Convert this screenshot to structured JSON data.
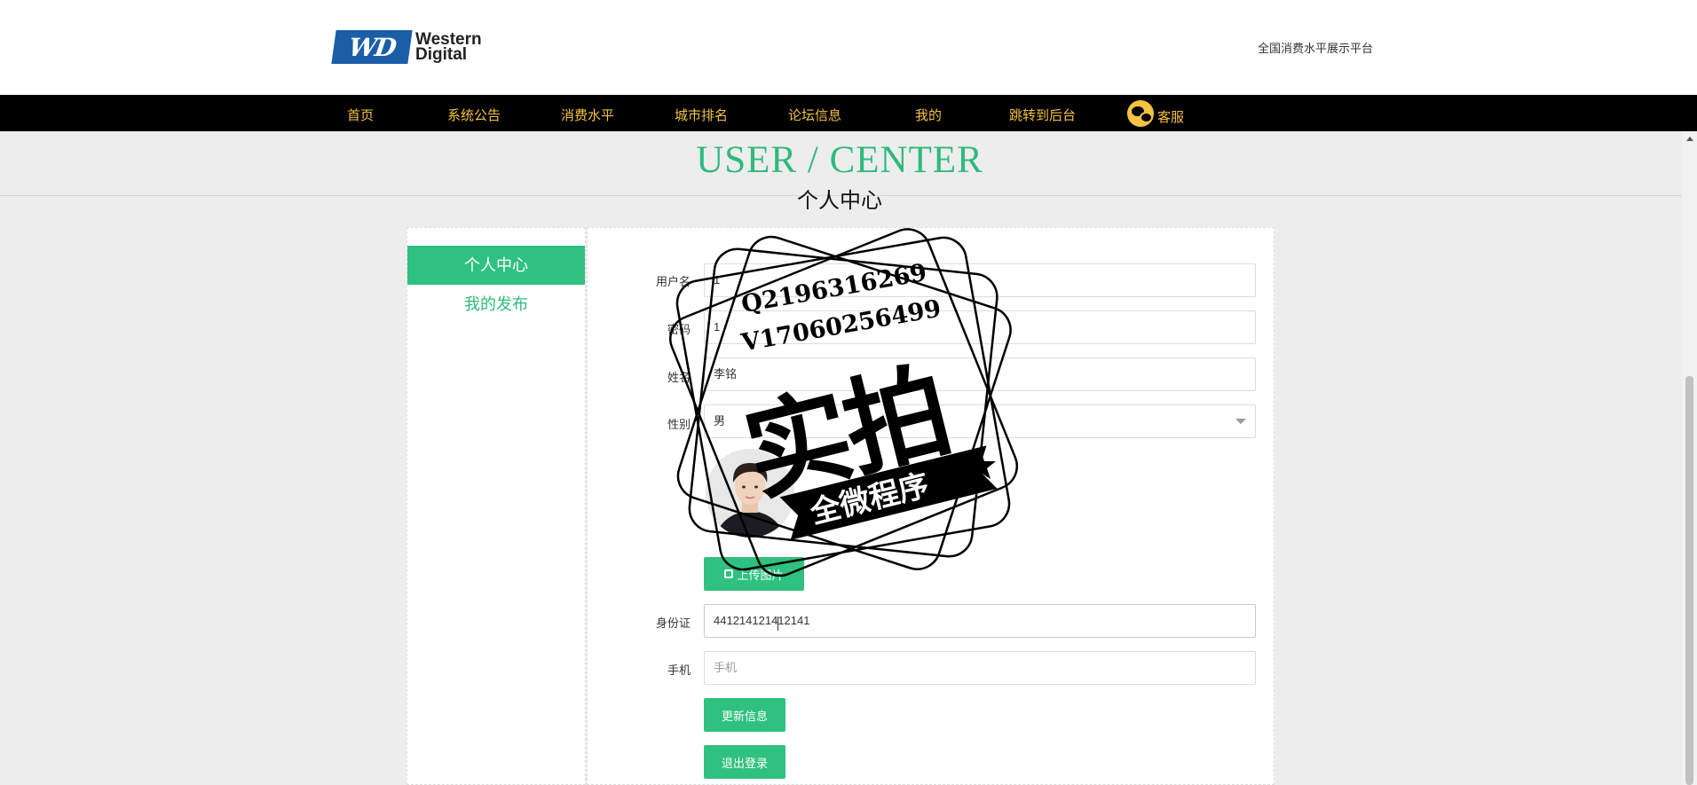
{
  "header": {
    "logo_line1": "Western",
    "logo_line2": "Digital",
    "logo_mark": "WD",
    "platform_name": "全国消费水平展示平台"
  },
  "nav": {
    "items": [
      "首页",
      "系统公告",
      "消费水平",
      "城市排名",
      "论坛信息",
      "我的",
      "跳转到后台"
    ],
    "service_label": "客服",
    "service_icon": "wechat-icon"
  },
  "title": {
    "en": "USER / CENTER",
    "cn": "个人中心"
  },
  "sidebar": {
    "items": [
      {
        "label": "个人中心",
        "active": true
      },
      {
        "label": "我的发布",
        "active": false
      }
    ]
  },
  "form": {
    "username": {
      "label": "用户名",
      "value": "1"
    },
    "password": {
      "label": "密码",
      "value": "1"
    },
    "name": {
      "label": "姓名",
      "value": "李铭"
    },
    "gender": {
      "label": "性别",
      "value": "男"
    },
    "upload_button": "上传图片",
    "id_card": {
      "label": "身份证",
      "value": "441214121412141"
    },
    "phone": {
      "label": "手机",
      "placeholder": "手机"
    },
    "update_button": "更新信息",
    "logout_button": "退出登录"
  },
  "watermark": {
    "line1": "Q2196316269",
    "line2": "V17060256499",
    "main": "实拍",
    "banner": "全微程序"
  },
  "colors": {
    "accent": "#2fc17f",
    "nav_bg": "#000000",
    "nav_text": "#f5c242",
    "page_bg": "#ededed"
  }
}
